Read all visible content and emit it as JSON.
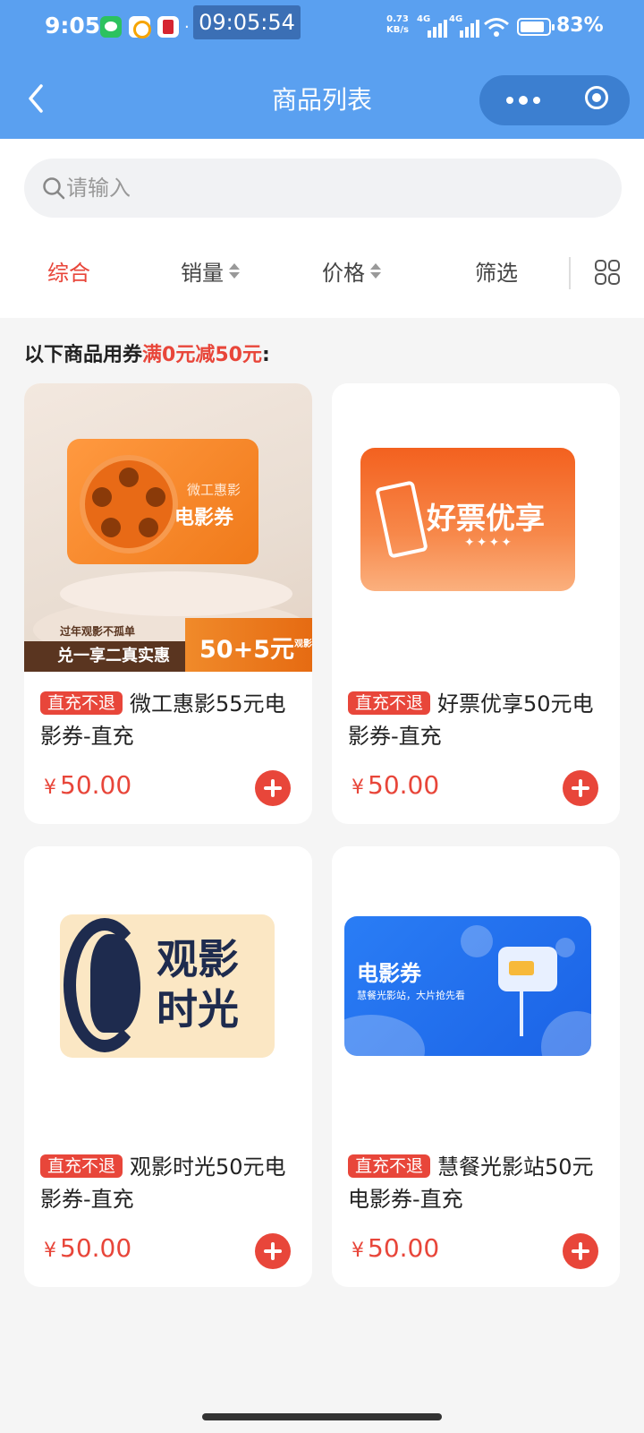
{
  "status_bar": {
    "time": "9:05",
    "clock_overlay": "09:05:54",
    "net_speed_value": "0.73",
    "net_speed_unit": "KB/s",
    "signal_1_label": "4G",
    "signal_2_label": "4G",
    "battery": "83%",
    "app_icons": [
      "wechat-icon",
      "qq-browser-icon",
      "kfc-icon"
    ]
  },
  "nav": {
    "title": "商品列表",
    "back_icon": "chevron-left-icon",
    "more_icon": "more-dots-icon",
    "close_icon": "target-circle-icon"
  },
  "search": {
    "placeholder": "请输入"
  },
  "filters": [
    {
      "label": "综合",
      "active": true
    },
    {
      "label": "销量",
      "sortable": true
    },
    {
      "label": "价格",
      "sortable": true
    },
    {
      "label": "筛选"
    }
  ],
  "coupon": {
    "prefix": "以下商品用券",
    "highlight": "满0元减50元",
    "suffix": ":"
  },
  "products": [
    {
      "tag": "直充不退",
      "title": "微工惠影55元电影券-直充",
      "price": "50.00",
      "currency": "¥",
      "image": {
        "card_small": "微工惠影",
        "card_big": "电影券",
        "banner_small": "过年观影不孤单",
        "banner_main": "兑一享二真实惠",
        "banner_price": "50+5元",
        "banner_unit": "观影券"
      }
    },
    {
      "tag": "直充不退",
      "title": "好票优享50元电影券-直充",
      "price": "50.00",
      "currency": "¥",
      "image": {
        "label": "好票优享",
        "stars": "✦✦✦✦"
      }
    },
    {
      "tag": "直充不退",
      "title": "观影时光50元电影券-直充",
      "price": "50.00",
      "currency": "¥",
      "image": {
        "line1": "观影",
        "line2": "时光"
      }
    },
    {
      "tag": "直充不退",
      "title": "慧餐光影站50元电影券-直充",
      "price": "50.00",
      "currency": "¥",
      "image": {
        "title": "电影券",
        "sub": "慧餐光影站，大片抢先看"
      }
    }
  ],
  "colors": {
    "nav_blue": "#5aa0f0",
    "accent_red": "#e8463a",
    "background": "#f5f5f5"
  }
}
